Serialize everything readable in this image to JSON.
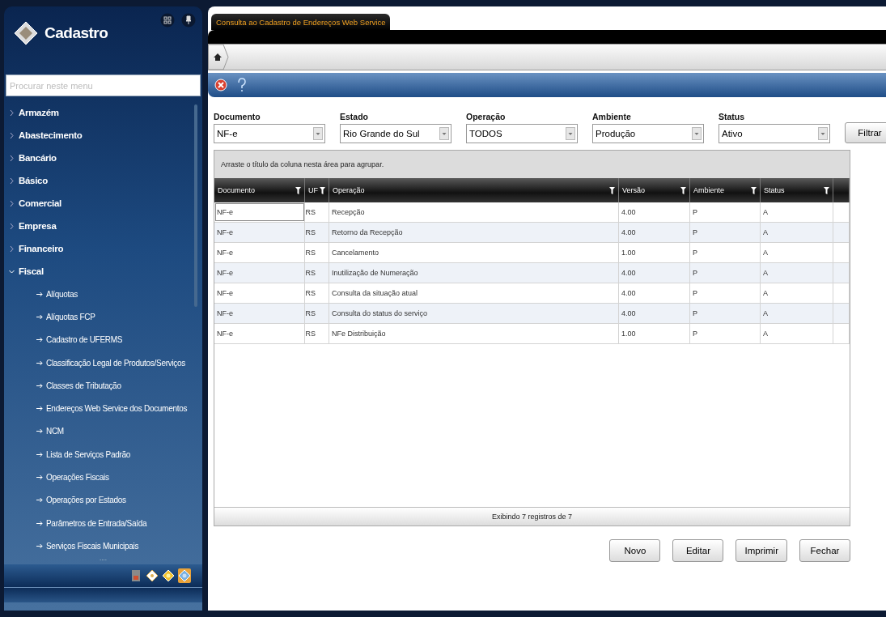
{
  "sidebar": {
    "title": "Cadastro",
    "search": {
      "placeholder": "Procurar neste menu"
    },
    "items": [
      {
        "label": "Armazém",
        "expanded": false
      },
      {
        "label": "Abastecimento",
        "expanded": false
      },
      {
        "label": "Bancário",
        "expanded": false
      },
      {
        "label": "Básico",
        "expanded": false
      },
      {
        "label": "Comercial",
        "expanded": false
      },
      {
        "label": "Empresa",
        "expanded": false
      },
      {
        "label": "Financeiro",
        "expanded": false
      },
      {
        "label": "Fiscal",
        "expanded": true,
        "children": [
          {
            "label": "Alíquotas"
          },
          {
            "label": "Alíquotas FCP"
          },
          {
            "label": "Cadastro de UFERMS"
          },
          {
            "label": "Classificação Legal de Produtos/Serviços"
          },
          {
            "label": "Classes de Tributação"
          },
          {
            "label": "Endereços Web Service dos Documentos"
          },
          {
            "label": "NCM"
          },
          {
            "label": "Lista de Serviços Padrão"
          },
          {
            "label": "Operações Fiscais"
          },
          {
            "label": "Operações por Estados"
          },
          {
            "label": "Parâmetros de Entrada/Saída"
          },
          {
            "label": "Serviços Fiscais Municipais"
          }
        ]
      }
    ],
    "more": "....",
    "dock": [
      {
        "kind": "calculator",
        "selected": false
      },
      {
        "kind": "diamond-white",
        "selected": false
      },
      {
        "kind": "diamond-yellow",
        "selected": false
      },
      {
        "kind": "diamond-blue",
        "selected": true
      }
    ]
  },
  "tab": {
    "title": "Consulta ao Cadastro de Endereços Web Service"
  },
  "filters": [
    {
      "label": "Documento",
      "value": "NF-e"
    },
    {
      "label": "Estado",
      "value": "Rio Grande do Sul"
    },
    {
      "label": "Operação",
      "value": "TODOS"
    },
    {
      "label": "Ambiente",
      "value": "Produção"
    },
    {
      "label": "Status",
      "value": "Ativo"
    }
  ],
  "filter_button": {
    "label": "Filtrar"
  },
  "table": {
    "group_hint": "Arraste o título da coluna nesta área para agrupar.",
    "columns": [
      "Documento",
      "UF",
      "Operação",
      "Versão",
      "Ambiente",
      "Status"
    ],
    "rows": [
      {
        "cells": [
          "NF-e",
          "RS",
          "Recepção",
          "4.00",
          "P",
          "A"
        ],
        "focused": true
      },
      {
        "cells": [
          "NF-e",
          "RS",
          "Retorno da Recepção",
          "4.00",
          "P",
          "A"
        ],
        "focused": false
      },
      {
        "cells": [
          "NF-e",
          "RS",
          "Cancelamento",
          "1.00",
          "P",
          "A"
        ],
        "focused": false
      },
      {
        "cells": [
          "NF-e",
          "RS",
          "Inutilização de Numeração",
          "4.00",
          "P",
          "A"
        ],
        "focused": false
      },
      {
        "cells": [
          "NF-e",
          "RS",
          "Consulta da situação atual",
          "4.00",
          "P",
          "A"
        ],
        "focused": false
      },
      {
        "cells": [
          "NF-e",
          "RS",
          "Consulta do status do serviço",
          "4.00",
          "P",
          "A"
        ],
        "focused": false
      },
      {
        "cells": [
          "NF-e",
          "RS",
          "NFe Distribuição",
          "1.00",
          "P",
          "A"
        ],
        "focused": false
      }
    ],
    "footer": "Exibindo 7 registros de 7"
  },
  "buttons": [
    {
      "label": "Novo"
    },
    {
      "label": "Editar"
    },
    {
      "label": "Imprimir"
    },
    {
      "label": "Fechar"
    }
  ]
}
